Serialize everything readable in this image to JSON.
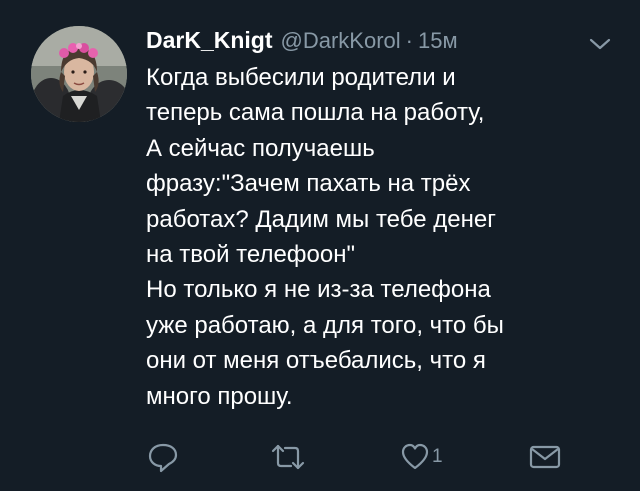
{
  "tweet": {
    "author": {
      "display_name": "DarK_Knigt",
      "handle": "@DarkKorol"
    },
    "separator": "·",
    "time": "15м",
    "text_lines": [
      "Когда выбесили родители и",
      "теперь сама пошла на работу,",
      "А сейчас получаешь",
      "фразу:\"Зачем пахать на трёх",
      "работах? Дадим мы тебе денег",
      "на твой телефоон\"",
      "Но только я не из-за телефона",
      "уже работаю, а для того, что бы",
      "они от меня отъебались, что я",
      "много прошу."
    ],
    "actions": {
      "reply_icon": "reply-icon",
      "retweet_icon": "retweet-icon",
      "like_icon": "heart-icon",
      "like_count": "1",
      "message_icon": "envelope-icon"
    }
  },
  "colors": {
    "background": "#141d26",
    "name": "#ffffff",
    "secondary": "#8899a6",
    "text": "#ffffff"
  }
}
